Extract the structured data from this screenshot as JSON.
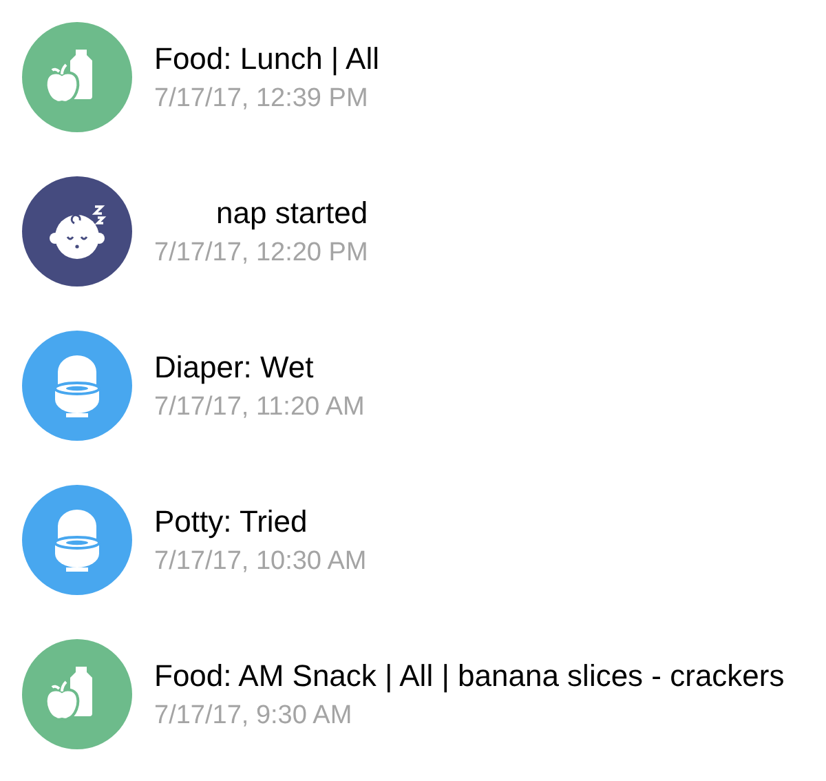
{
  "events": [
    {
      "kind": "food",
      "title": "Food: Lunch | All",
      "time": "7/17/17, 12:39 PM"
    },
    {
      "kind": "nap",
      "title": "nap started",
      "time": "7/17/17, 12:20 PM"
    },
    {
      "kind": "potty",
      "title": "Diaper: Wet",
      "time": "7/17/17, 11:20 AM"
    },
    {
      "kind": "potty",
      "title": "Potty: Tried",
      "time": "7/17/17, 10:30 AM"
    },
    {
      "kind": "food",
      "title": "Food: AM Snack | All | banana slices - crackers",
      "time": "7/17/17, 9:30 AM"
    }
  ]
}
